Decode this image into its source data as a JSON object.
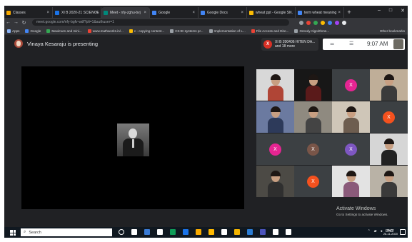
{
  "browser": {
    "tabs": [
      {
        "label": "Classes",
        "color": "#f9ab00"
      },
      {
        "label": "XI B 2020-21 SCIENCE",
        "color": "#1a73e8"
      },
      {
        "label": "Meet - nfy-zghu-bvj",
        "color": "#00897b"
      },
      {
        "label": "Google",
        "color": "#4285f4"
      },
      {
        "label": "Google Docs",
        "color": "#4285f4"
      },
      {
        "label": "wheat ppt - Google Sl...",
        "color": "#fbbc04"
      },
      {
        "label": "term wheat meaning",
        "color": "#4285f4"
      }
    ],
    "url": "meet.google.com/nfy-bgfv-wdf?pli=1&authuser=1",
    "bookmarks": [
      {
        "label": "Apps",
        "color": "#8ab4f8"
      },
      {
        "label": "Google",
        "color": "#4285f4"
      },
      {
        "label": "Maximum and mini...",
        "color": "#34a853"
      },
      {
        "label": "www.mathworks.in/...",
        "color": "#ea4335"
      },
      {
        "label": "c - copying content...",
        "color": "#fbbc04"
      },
      {
        "label": "CS:IE-systems pr...",
        "color": "#9aa0a6"
      },
      {
        "label": "Implementation of L...",
        "color": "#9aa0a6"
      },
      {
        "label": "File Access and Dire...",
        "color": "#ea4335"
      },
      {
        "label": "Greedy Algorithms...",
        "color": "#9aa0a6"
      }
    ],
    "other_bookmarks": "Other bookmarks"
  },
  "meet": {
    "presenter_text": "Vinaya Kesaraju is presenting",
    "participants_pill": "XI B 200406 HITEN DA... and 18 more",
    "time": "9:07 AM",
    "tiles": [
      {
        "type": "person",
        "bg": "#d8d8d8",
        "shirt": "#b04536"
      },
      {
        "type": "person",
        "bg": "#171717",
        "shirt": "#5a1a1a"
      },
      {
        "type": "avatar",
        "letter": "X",
        "color": "#e52592"
      },
      {
        "type": "person",
        "bg": "#bfae98",
        "shirt": "#3b3b3b"
      },
      {
        "type": "person",
        "bg": "#6b7aa0",
        "shirt": "#2d3a5a"
      },
      {
        "type": "person",
        "bg": "#8f8a80",
        "shirt": "#444444"
      },
      {
        "type": "person",
        "bg": "#cfc6b8",
        "shirt": "#6d5d4f"
      },
      {
        "type": "avatar",
        "letter": "X",
        "color": "#f4511e"
      },
      {
        "type": "avatar",
        "letter": "X",
        "color": "#e52592"
      },
      {
        "type": "avatar",
        "letter": "X",
        "color": "#795548"
      },
      {
        "type": "avatar",
        "letter": "X",
        "color": "#7e57c2"
      },
      {
        "type": "person",
        "bg": "#d6d6d6",
        "shirt": "#222222"
      },
      {
        "type": "person",
        "bg": "#4c4a45",
        "shirt": "#2f2f2f"
      },
      {
        "type": "avatar",
        "letter": "X",
        "color": "#f4511e"
      },
      {
        "type": "person",
        "bg": "#e3e3e3",
        "shirt": "#8a5a7a"
      },
      {
        "type": "person",
        "bg": "#b9b2a6",
        "shirt": "#3a3a3a"
      }
    ]
  },
  "windows": {
    "watermark_title": "Activate Windows",
    "watermark_sub": "Go to Settings to activate Windows.",
    "search_placeholder": "Search",
    "taskbar_icons": [
      "#ffffff",
      "#ffffff",
      "#3a7bd5",
      "#ffffff",
      "#0f9d58",
      "#1a73e8",
      "#f9ab00",
      "#ffb900",
      "#ffffff",
      "#f4b400",
      "#2b7cd3",
      "#4b53bc",
      "#ffffff",
      "#ffffff"
    ],
    "tray": "ENG",
    "clock_time": "09:07",
    "clock_date": "26-11-2020"
  }
}
